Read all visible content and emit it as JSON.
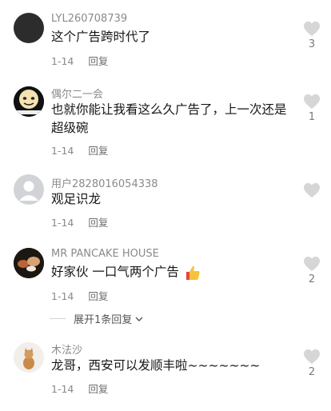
{
  "comments": [
    {
      "username": "LYL260708739",
      "content": "这个广告跨时代了",
      "date": "1-14",
      "reply": "回复",
      "likes": "3"
    },
    {
      "username": "偶尔二一会",
      "content": "也就你能让我看这么久广告了，上一次还是超级碗",
      "date": "1-14",
      "reply": "回复",
      "likes": "1"
    },
    {
      "username": "用户2828016054338",
      "content": "观足识龙",
      "date": "1-14",
      "reply": "回复",
      "likes": ""
    },
    {
      "username": "MR PANCAKE HOUSE",
      "content": "好家伙 一口气两个广告",
      "date": "1-14",
      "reply": "回复",
      "likes": "2"
    },
    {
      "username": "木法沙",
      "content": "龙哥，西安可以发顺丰啦~~~~~~~",
      "date": "1-14",
      "reply": "回复",
      "likes": "2"
    }
  ],
  "expand_replies": "展开1条回复",
  "icons": {
    "like": "heart-icon",
    "expand": "chevron-down-icon"
  },
  "colors": {
    "text": "#161616",
    "muted": "#8a8a8a",
    "heart": "#d6d6d6"
  }
}
